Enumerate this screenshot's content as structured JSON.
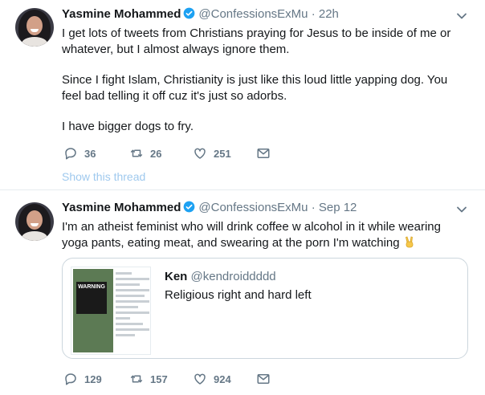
{
  "tweets": [
    {
      "author": "Yasmine Mohammed",
      "handle": "@ConfessionsExMu",
      "separator": "·",
      "time": "22h",
      "paragraphs": [
        "I get lots of tweets from Christians praying for Jesus to be inside of me or whatever, but I almost always ignore them.",
        "Since I fight Islam, Christianity is just like this loud little yapping dog. You feel bad telling it off cuz it's just so adorbs.",
        "I have bigger dogs to fry."
      ],
      "replies": "36",
      "retweets": "26",
      "likes": "251",
      "show_thread": "Show this thread"
    },
    {
      "author": "Yasmine Mohammed",
      "handle": "@ConfessionsExMu",
      "separator": "·",
      "time": "Sep 12",
      "text": "I'm an atheist feminist who will drink coffee w alcohol in it while wearing yoga pants, eating meat, and swearing at the porn I'm watching",
      "quote": {
        "author": "Ken",
        "handle": "@kendroiddddd",
        "text": "Religious right and hard left",
        "image_sign_text": "WARNING"
      },
      "replies": "129",
      "retweets": "157",
      "likes": "924"
    }
  ],
  "colors": {
    "verified": "#1da1f2",
    "muted": "#657786",
    "thread_link": "#9fc9ee",
    "border": "#e6ecf0"
  },
  "icons": [
    "verified-badge-icon",
    "chevron-down-icon",
    "reply-icon",
    "retweet-icon",
    "like-icon",
    "message-icon",
    "victory-hand-emoji"
  ]
}
